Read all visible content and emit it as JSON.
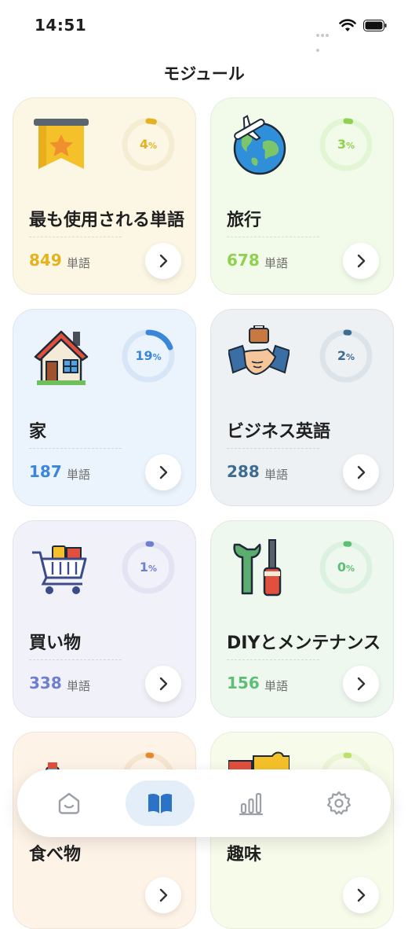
{
  "status_bar": {
    "time": "14:51"
  },
  "header": {
    "title": "モジュール"
  },
  "modules": [
    {
      "name": "最も使用される単語",
      "percent": 4,
      "count": "849",
      "unit": "単語",
      "accent": "#e3b21f",
      "icon": "bookmark-star-icon"
    },
    {
      "name": "旅行",
      "percent": 3,
      "count": "678",
      "unit": "単語",
      "accent": "#8fd14f",
      "icon": "globe-airplane-icon"
    },
    {
      "name": "家",
      "percent": 19,
      "count": "187",
      "unit": "単語",
      "accent": "#3a86d8",
      "icon": "house-icon"
    },
    {
      "name": "ビジネス英語",
      "percent": 2,
      "count": "288",
      "unit": "単語",
      "accent": "#3d6c92",
      "icon": "handshake-icon"
    },
    {
      "name": "買い物",
      "percent": 1,
      "count": "338",
      "unit": "単語",
      "accent": "#6f7fd0",
      "icon": "shopping-cart-icon"
    },
    {
      "name": "DIYとメンテナンス",
      "percent": 0,
      "count": "156",
      "unit": "単語",
      "accent": "#5cbf75",
      "icon": "tools-icon"
    },
    {
      "name": "食べ物",
      "percent": 2,
      "count": "",
      "unit": "",
      "accent": "#e58a2c",
      "icon": "food-icon"
    },
    {
      "name": "趣味",
      "percent": 1,
      "count": "",
      "unit": "",
      "accent": "#bde06a",
      "icon": "puzzle-icon"
    }
  ],
  "tab_bar": {
    "tabs": [
      {
        "icon": "home-icon",
        "active": false
      },
      {
        "icon": "book-icon",
        "active": true
      },
      {
        "icon": "stats-icon",
        "active": false
      },
      {
        "icon": "settings-icon",
        "active": false
      }
    ]
  }
}
